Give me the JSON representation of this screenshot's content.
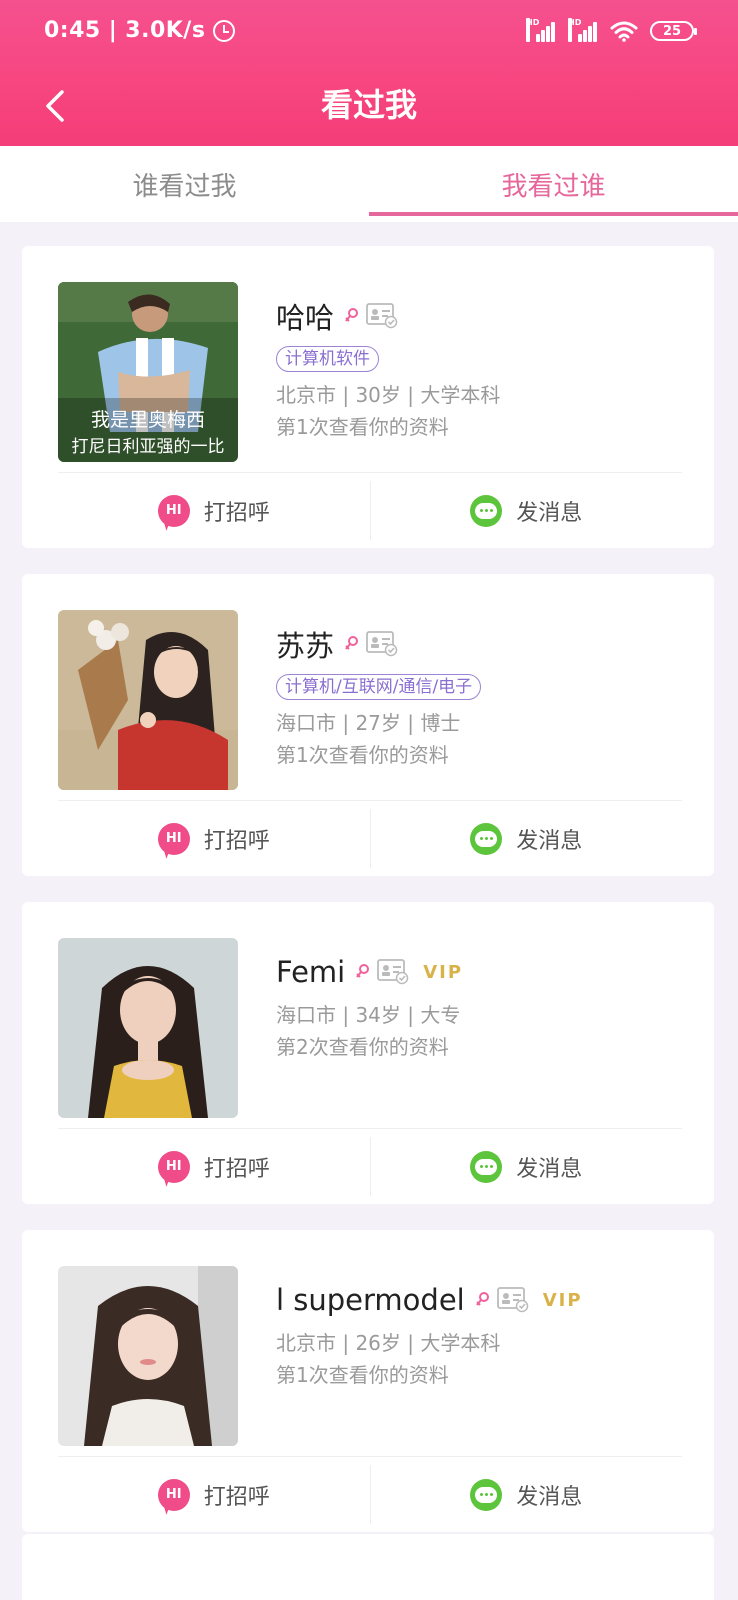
{
  "status_bar": {
    "time": "0:45",
    "network_speed": "3.0K/s",
    "battery": "25",
    "signal_label": "HD"
  },
  "header": {
    "title": "看过我"
  },
  "tabs": [
    {
      "label": "谁看过我",
      "active": false
    },
    {
      "label": "我看过谁",
      "active": true
    }
  ],
  "cards": [
    {
      "name": "哈哈",
      "tag": "计算机软件",
      "vip": "",
      "location_age_edu": "北京市 | 30岁 | 大学本科",
      "view_count": "第1次查看你的资料",
      "avatar_caption_line1": "我是里奥梅西",
      "avatar_caption_line2": "打尼日利亚强的一比"
    },
    {
      "name": "苏苏",
      "tag": "计算机/互联网/通信/电子",
      "vip": "",
      "location_age_edu": "海口市 | 27岁 | 博士",
      "view_count": "第1次查看你的资料"
    },
    {
      "name": "Femi",
      "tag": "",
      "vip": "VIP",
      "location_age_edu": "海口市 | 34岁 | 大专",
      "view_count": "第2次查看你的资料"
    },
    {
      "name": "l supermodel",
      "tag": "",
      "vip": "VIP",
      "location_age_edu": "北京市 | 26岁 | 大学本科",
      "view_count": "第1次查看你的资料"
    }
  ],
  "actions": {
    "greet_label": "打招呼",
    "greet_icon_text": "HI",
    "message_label": "发消息"
  },
  "colors": {
    "header_pink": "#f64a85",
    "accent_pink": "#e6679b",
    "tag_purple": "#8a6fd0",
    "vip_gold": "#d9b24a",
    "message_green": "#5cc53b"
  }
}
